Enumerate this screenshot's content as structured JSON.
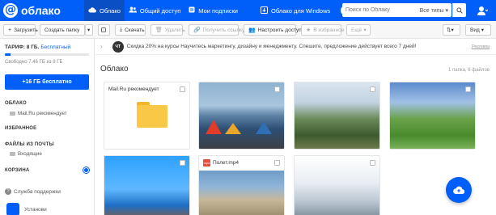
{
  "brand": {
    "logo_text": "облако",
    "accent": "#005ff9"
  },
  "nav": {
    "items": [
      {
        "label": "Облако",
        "icon": "cloud-icon",
        "active": true
      },
      {
        "label": "Общий доступ",
        "icon": "users-icon",
        "active": false
      },
      {
        "label": "Мои подписки",
        "icon": "subscriptions-icon",
        "active": false
      },
      {
        "label": "Облако для Windows",
        "icon": "windows-icon",
        "active": false
      }
    ],
    "help_label": "?"
  },
  "search": {
    "placeholder": "Поиск по Облаку",
    "filter_label": "Все типы"
  },
  "toolbar": {
    "upload_label": "Загрузить",
    "create_folder_label": "Создать папку",
    "download_label": "Скачать",
    "delete_label": "Удалить",
    "get_link_label": "Получить ссылку",
    "share_label": "Настроить доступ",
    "favorite_label": "В избранное",
    "more_label": "Ещё",
    "view_label": "Вид"
  },
  "sidebar": {
    "plan_label": "ТАРИФ: 8 ГБ.",
    "plan_free": "Бесплатный",
    "quota_text": "Свободно 7.46 ГБ из 8 ГБ",
    "quota_used_fraction": 0.07,
    "free_button": "+16 ГБ бесплатно",
    "section_cloud": "ОБЛАКО",
    "cloud_item": "Mail.Ru рекомендует",
    "section_favorites": "ИЗБРАННОЕ",
    "section_mail": "ФАЙЛЫ ИЗ ПОЧТЫ",
    "mail_item": "Входящие",
    "section_trash": "КОРЗИНА",
    "support_label": "Служба поддержки",
    "install_label": "Установи"
  },
  "promo": {
    "logo_text": "ЧТ",
    "text": "Скидка 20% на курсы   Научитесь маркетингу, дизайну и менеджменту. Спешите, предложение действует всего 7 дней!",
    "ad_label": "Реклама"
  },
  "main": {
    "title": "Облако",
    "count": "1 папка, 6 файлов"
  },
  "tiles": [
    {
      "type": "folder",
      "name": "Mail.Ru рекомендует"
    },
    {
      "type": "photo"
    },
    {
      "type": "photo"
    },
    {
      "type": "photo"
    },
    {
      "type": "photo"
    },
    {
      "type": "video",
      "name": "Полет.mp4"
    },
    {
      "type": "photo"
    }
  ]
}
